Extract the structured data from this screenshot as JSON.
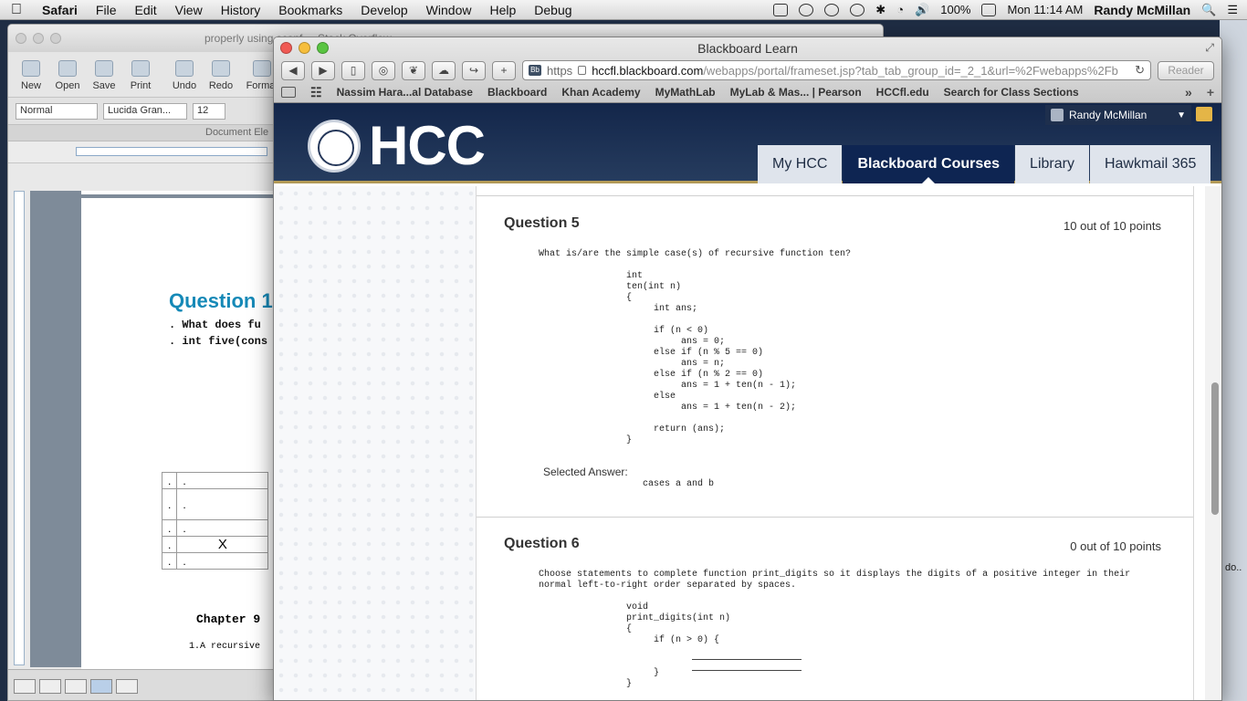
{
  "menubar": {
    "apple": "",
    "app": "Safari",
    "items": [
      "File",
      "Edit",
      "View",
      "History",
      "Bookmarks",
      "Develop",
      "Window",
      "Help",
      "Debug"
    ],
    "battery": "100%",
    "clock": "Mon 11:14 AM",
    "user": "Randy McMillan"
  },
  "desktop": {
    "right_text": "do.."
  },
  "word": {
    "tabs_behind": "properly using scanf ... Stack Overflow",
    "toolbar": [
      "New",
      "Open",
      "Save",
      "Print",
      "Undo",
      "Redo",
      "Format"
    ],
    "style_combo": "Normal",
    "font_combo": "Lucida Gran...",
    "size_combo": "12",
    "gallery_label": "Document Ele",
    "question_title": "Question 1",
    "line1": ".  What does fu",
    "line2": ". int five(cons",
    "table": [
      [
        ".",
        "."
      ],
      [
        ".",
        "."
      ],
      [
        ".",
        "."
      ],
      [
        ".",
        "X"
      ],
      [
        ".",
        "."
      ]
    ],
    "chapter": "Chapter 9",
    "recursive": "1.A recursive"
  },
  "safari": {
    "title": "Blackboard Learn",
    "nav": {
      "back": "◀",
      "forward": "▶",
      "share": "↪",
      "add": "+"
    },
    "url": {
      "scheme": "https",
      "host": "hccfl.blackboard.com",
      "path": "/webapps/portal/frameset.jsp?tab_tab_group_id=_2_1&url=%2Fwebapps%2Fb"
    },
    "reader": "Reader",
    "bookmarks": [
      "Nassim Hara...al Database",
      "Blackboard",
      "Khan Academy",
      "MyMathLab",
      "MyLab & Mas... | Pearson",
      "HCCfl.edu",
      "Search for Class Sections"
    ],
    "bookmarks_more": "»"
  },
  "hcc": {
    "logo": "HCC",
    "user": "Randy McMillan",
    "tabs": [
      "My HCC",
      "Blackboard Courses",
      "Library",
      "Hawkmail 365"
    ],
    "active_tab": "Blackboard Courses"
  },
  "questions": [
    {
      "title": "Question 5",
      "points": "10 out of 10 points",
      "prompt": "What is/are the simple case(s) of recursive function ten?",
      "code": "int\nten(int n)\n{\n     int ans;\n\n     if (n < 0)\n          ans = 0;\n     else if (n % 5 == 0)\n          ans = n;\n     else if (n % 2 == 0)\n          ans = 1 + ten(n - 1);\n     else\n          ans = 1 + ten(n - 2);\n\n     return (ans);\n}",
      "selected_label": "Selected Answer:",
      "selected_value": "cases a and b"
    },
    {
      "title": "Question 6",
      "points": "0 out of 10 points",
      "prompt": "Choose statements to complete function print_digits so it displays the digits of a positive integer in their\nnormal left-to-right order separated by spaces.",
      "code": "void\nprint_digits(int n)\n{\n     if (n > 0) {\n\n\n     }\n}"
    }
  ],
  "colors": {
    "hcc_header": "#13264a",
    "active_tab": "#0e2552",
    "question_title_word": "#1589b7",
    "gold_rule": "#b39a57"
  }
}
